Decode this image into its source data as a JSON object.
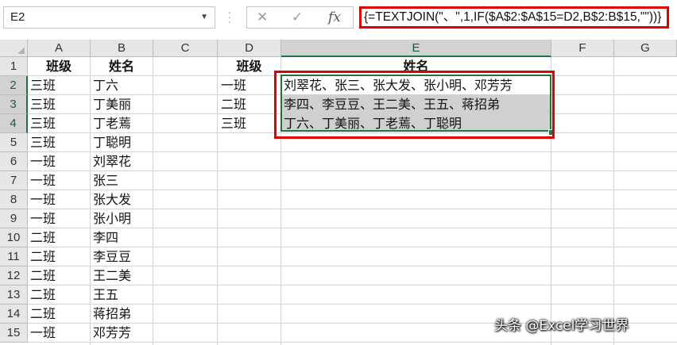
{
  "formula_bar": {
    "name_box": "E2",
    "cancel_icon": "✕",
    "enter_icon": "✓",
    "fx_icon": "fx",
    "formula": "{=TEXTJOIN(\"、\",1,IF($A$2:$A$15=D2,B$2:B$15,\"\"))}"
  },
  "columns": [
    "A",
    "B",
    "C",
    "D",
    "E",
    "F",
    "G"
  ],
  "rows": [
    "1",
    "2",
    "3",
    "4",
    "5",
    "6",
    "7",
    "8",
    "9",
    "10",
    "11",
    "12",
    "13",
    "14",
    "15"
  ],
  "table": {
    "header_class": "班级",
    "header_name": "姓名",
    "rows": [
      {
        "class": "三班",
        "name": "丁六"
      },
      {
        "class": "三班",
        "name": "丁美丽"
      },
      {
        "class": "三班",
        "name": "丁老蔫"
      },
      {
        "class": "三班",
        "name": "丁聪明"
      },
      {
        "class": "一班",
        "name": "刘翠花"
      },
      {
        "class": "一班",
        "name": "张三"
      },
      {
        "class": "一班",
        "name": "张大发"
      },
      {
        "class": "一班",
        "name": "张小明"
      },
      {
        "class": "二班",
        "name": "李四"
      },
      {
        "class": "二班",
        "name": "李豆豆"
      },
      {
        "class": "二班",
        "name": "王二美"
      },
      {
        "class": "二班",
        "name": "王五"
      },
      {
        "class": "二班",
        "name": "蒋招弟"
      },
      {
        "class": "一班",
        "name": "邓芳芳"
      }
    ]
  },
  "summary": {
    "header_class": "班级",
    "header_names": "姓名",
    "rows": [
      {
        "class": "一班",
        "names": "刘翠花、张三、张大发、张小明、邓芳芳"
      },
      {
        "class": "二班",
        "names": "李四、李豆豆、王二美、王五、蒋招弟"
      },
      {
        "class": "三班",
        "names": "丁六、丁美丽、丁老蔫、丁聪明"
      }
    ]
  },
  "watermark": "头条 @Excel学习世界",
  "colors": {
    "accent": "#217346",
    "highlight": "#e00000"
  }
}
